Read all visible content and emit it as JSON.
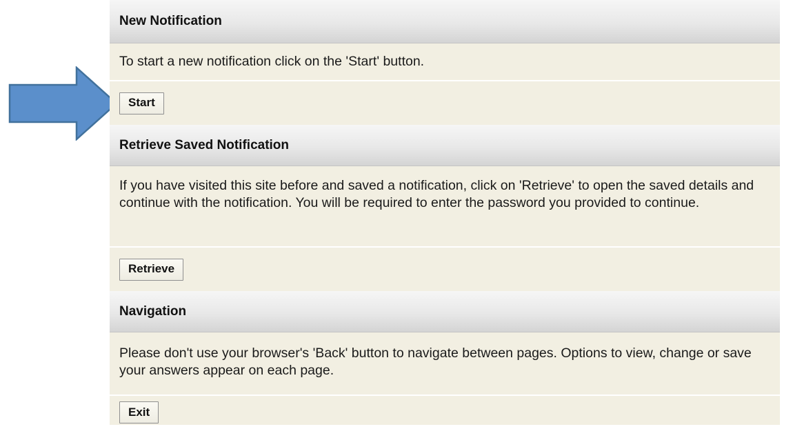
{
  "sections": [
    {
      "header": "New Notification",
      "text": "To start a new notification click on the 'Start' button.",
      "button": "Start"
    },
    {
      "header": "Retrieve Saved Notification",
      "text": "If you have visited this site before and saved a notification, click on 'Retrieve' to open the saved details and continue with the notification. You will be required to enter the password you provided to continue.",
      "button": "Retrieve"
    },
    {
      "header": "Navigation",
      "text": "Please don't use your browser's 'Back' button to navigate between pages. Options to view, change or save your answers appear on each page.",
      "button": "Exit"
    }
  ],
  "annotation": {
    "icon": "arrow-right-icon",
    "fill_color": "#5b8fcb",
    "stroke_color": "#41719c"
  }
}
